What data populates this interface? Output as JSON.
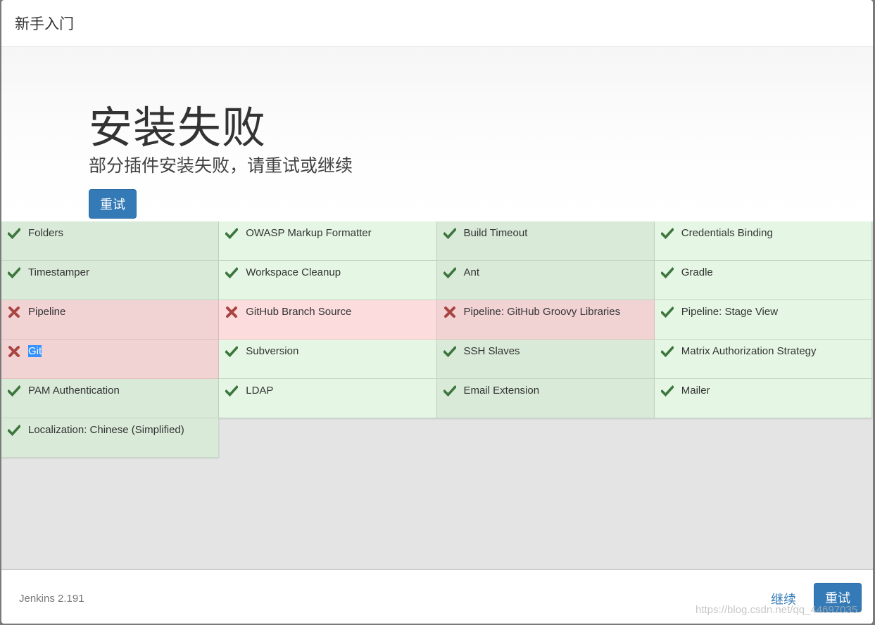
{
  "header": {
    "title": "新手入门"
  },
  "main": {
    "title": "安装失败",
    "subtitle": "部分插件安装失败，请重试或继续",
    "retry_label": "重试"
  },
  "plugins": [
    {
      "name": "Folders",
      "status": "success"
    },
    {
      "name": "OWASP Markup Formatter",
      "status": "success"
    },
    {
      "name": "Build Timeout",
      "status": "success"
    },
    {
      "name": "Credentials Binding",
      "status": "success"
    },
    {
      "name": "Timestamper",
      "status": "success"
    },
    {
      "name": "Workspace Cleanup",
      "status": "success"
    },
    {
      "name": "Ant",
      "status": "success"
    },
    {
      "name": "Gradle",
      "status": "success"
    },
    {
      "name": "Pipeline",
      "status": "failed"
    },
    {
      "name": "GitHub Branch Source",
      "status": "failed"
    },
    {
      "name": "Pipeline: GitHub Groovy Libraries",
      "status": "failed"
    },
    {
      "name": "Pipeline: Stage View",
      "status": "success"
    },
    {
      "name": "Git",
      "status": "failed",
      "selected": true
    },
    {
      "name": "Subversion",
      "status": "success"
    },
    {
      "name": "SSH Slaves",
      "status": "success"
    },
    {
      "name": "Matrix Authorization Strategy",
      "status": "success"
    },
    {
      "name": "PAM Authentication",
      "status": "success"
    },
    {
      "name": "LDAP",
      "status": "success"
    },
    {
      "name": "Email Extension",
      "status": "success"
    },
    {
      "name": "Mailer",
      "status": "success"
    },
    {
      "name": "Localization: Chinese (Simplified)",
      "status": "success"
    }
  ],
  "icons": {
    "success": "check-icon",
    "failed": "cross-icon"
  },
  "colors": {
    "primary": "#337ab7",
    "success_icon": "#3c763d",
    "failed_icon": "#a94442"
  },
  "footer": {
    "version": "Jenkins 2.191",
    "continue_label": "继续",
    "retry_label": "重试",
    "watermark": "https://blog.csdn.net/qq_44697035"
  }
}
